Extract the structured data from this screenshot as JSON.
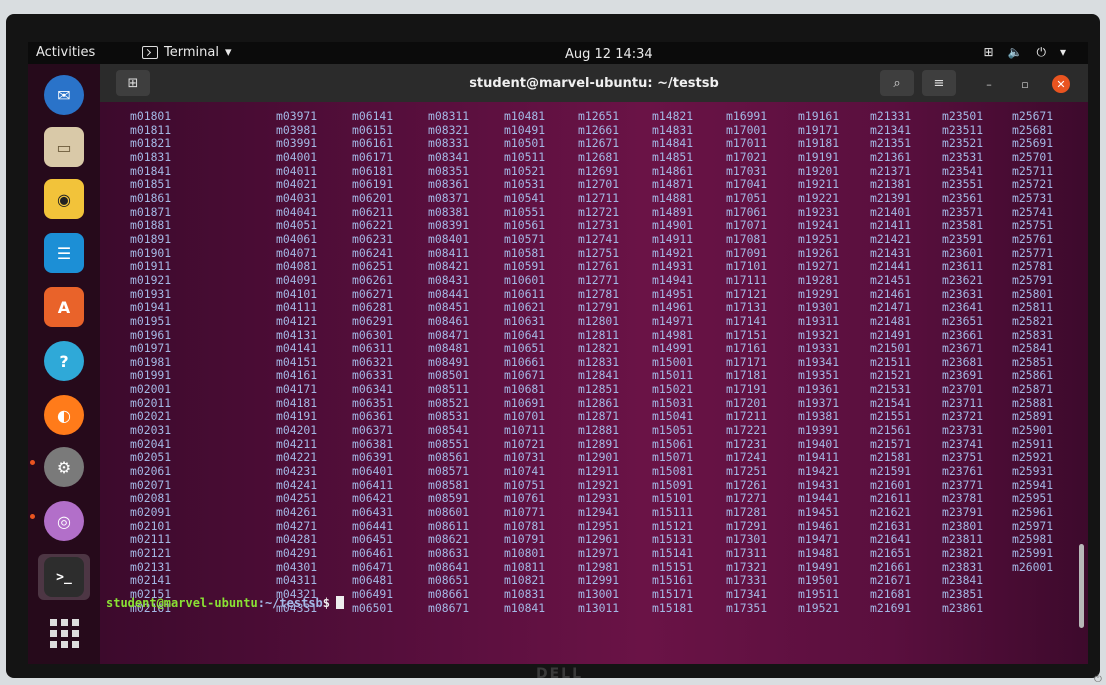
{
  "topbar": {
    "activities": "Activities",
    "app_name": "Terminal",
    "clock": "Aug 12  14:34"
  },
  "dock": {
    "items": [
      {
        "name": "thunderbird",
        "icon": "mail-bird-icon",
        "color": "#2a73c9"
      },
      {
        "name": "files",
        "icon": "folder-icon",
        "color": "#d9c9a8"
      },
      {
        "name": "rhythmbox",
        "icon": "speaker-icon",
        "color": "#f2c33a"
      },
      {
        "name": "writer",
        "icon": "document-icon",
        "color": "#1c8fd6"
      },
      {
        "name": "software",
        "icon": "shopping-bag-icon",
        "color": "#e9632a"
      },
      {
        "name": "help",
        "icon": "help-icon",
        "color": "#2fa9d8"
      },
      {
        "name": "firefox",
        "icon": "firefox-icon",
        "color": "#ff7b1a"
      },
      {
        "name": "settings",
        "icon": "gear-icon",
        "color": "#7a7a7a"
      },
      {
        "name": "browser",
        "icon": "globe-icon",
        "color": "#b26fc9"
      },
      {
        "name": "terminal",
        "icon": "terminal-icon",
        "color": "#2d2d2d"
      },
      {
        "name": "show-apps",
        "icon": "grid-icon",
        "color": "#dddddd"
      }
    ]
  },
  "terminal": {
    "title": "student@marvel-ubuntu: ~/testsb",
    "prompt_user": "student@marvel-ubuntu",
    "prompt_path": ":~/testsb",
    "prompt_symbol": "$",
    "text_color": "#a4b9e6",
    "prompt_color": "#8ae234",
    "columns": [
      [
        "m01801",
        "m01811",
        "m01821",
        "m01831",
        "m01841",
        "m01851",
        "m01861",
        "m01871",
        "m01881",
        "m01891",
        "m01901",
        "m01911",
        "m01921",
        "m01931",
        "m01941",
        "m01951",
        "m01961",
        "m01971",
        "m01981",
        "m01991",
        "m02001",
        "m02011",
        "m02021",
        "m02031",
        "m02041",
        "m02051",
        "m02061",
        "m02071",
        "m02081",
        "m02091",
        "m02101",
        "m02111",
        "m02121",
        "m02131",
        "m02141",
        "m02151",
        "m02161"
      ],
      [
        "m03971",
        "m03981",
        "m03991",
        "m04001",
        "m04011",
        "m04021",
        "m04031",
        "m04041",
        "m04051",
        "m04061",
        "m04071",
        "m04081",
        "m04091",
        "m04101",
        "m04111",
        "m04121",
        "m04131",
        "m04141",
        "m04151",
        "m04161",
        "m04171",
        "m04181",
        "m04191",
        "m04201",
        "m04211",
        "m04221",
        "m04231",
        "m04241",
        "m04251",
        "m04261",
        "m04271",
        "m04281",
        "m04291",
        "m04301",
        "m04311",
        "m04321",
        "m04331"
      ],
      [
        "m06141",
        "m06151",
        "m06161",
        "m06171",
        "m06181",
        "m06191",
        "m06201",
        "m06211",
        "m06221",
        "m06231",
        "m06241",
        "m06251",
        "m06261",
        "m06271",
        "m06281",
        "m06291",
        "m06301",
        "m06311",
        "m06321",
        "m06331",
        "m06341",
        "m06351",
        "m06361",
        "m06371",
        "m06381",
        "m06391",
        "m06401",
        "m06411",
        "m06421",
        "m06431",
        "m06441",
        "m06451",
        "m06461",
        "m06471",
        "m06481",
        "m06491",
        "m06501"
      ],
      [
        "m08311",
        "m08321",
        "m08331",
        "m08341",
        "m08351",
        "m08361",
        "m08371",
        "m08381",
        "m08391",
        "m08401",
        "m08411",
        "m08421",
        "m08431",
        "m08441",
        "m08451",
        "m08461",
        "m08471",
        "m08481",
        "m08491",
        "m08501",
        "m08511",
        "m08521",
        "m08531",
        "m08541",
        "m08551",
        "m08561",
        "m08571",
        "m08581",
        "m08591",
        "m08601",
        "m08611",
        "m08621",
        "m08631",
        "m08641",
        "m08651",
        "m08661",
        "m08671"
      ],
      [
        "m10481",
        "m10491",
        "m10501",
        "m10511",
        "m10521",
        "m10531",
        "m10541",
        "m10551",
        "m10561",
        "m10571",
        "m10581",
        "m10591",
        "m10601",
        "m10611",
        "m10621",
        "m10631",
        "m10641",
        "m10651",
        "m10661",
        "m10671",
        "m10681",
        "m10691",
        "m10701",
        "m10711",
        "m10721",
        "m10731",
        "m10741",
        "m10751",
        "m10761",
        "m10771",
        "m10781",
        "m10791",
        "m10801",
        "m10811",
        "m10821",
        "m10831",
        "m10841"
      ],
      [
        "m12651",
        "m12661",
        "m12671",
        "m12681",
        "m12691",
        "m12701",
        "m12711",
        "m12721",
        "m12731",
        "m12741",
        "m12751",
        "m12761",
        "m12771",
        "m12781",
        "m12791",
        "m12801",
        "m12811",
        "m12821",
        "m12831",
        "m12841",
        "m12851",
        "m12861",
        "m12871",
        "m12881",
        "m12891",
        "m12901",
        "m12911",
        "m12921",
        "m12931",
        "m12941",
        "m12951",
        "m12961",
        "m12971",
        "m12981",
        "m12991",
        "m13001",
        "m13011"
      ],
      [
        "m14821",
        "m14831",
        "m14841",
        "m14851",
        "m14861",
        "m14871",
        "m14881",
        "m14891",
        "m14901",
        "m14911",
        "m14921",
        "m14931",
        "m14941",
        "m14951",
        "m14961",
        "m14971",
        "m14981",
        "m14991",
        "m15001",
        "m15011",
        "m15021",
        "m15031",
        "m15041",
        "m15051",
        "m15061",
        "m15071",
        "m15081",
        "m15091",
        "m15101",
        "m15111",
        "m15121",
        "m15131",
        "m15141",
        "m15151",
        "m15161",
        "m15171",
        "m15181"
      ],
      [
        "m16991",
        "m17001",
        "m17011",
        "m17021",
        "m17031",
        "m17041",
        "m17051",
        "m17061",
        "m17071",
        "m17081",
        "m17091",
        "m17101",
        "m17111",
        "m17121",
        "m17131",
        "m17141",
        "m17151",
        "m17161",
        "m17171",
        "m17181",
        "m17191",
        "m17201",
        "m17211",
        "m17221",
        "m17231",
        "m17241",
        "m17251",
        "m17261",
        "m17271",
        "m17281",
        "m17291",
        "m17301",
        "m17311",
        "m17321",
        "m17331",
        "m17341",
        "m17351"
      ],
      [
        "m19161",
        "m19171",
        "m19181",
        "m19191",
        "m19201",
        "m19211",
        "m19221",
        "m19231",
        "m19241",
        "m19251",
        "m19261",
        "m19271",
        "m19281",
        "m19291",
        "m19301",
        "m19311",
        "m19321",
        "m19331",
        "m19341",
        "m19351",
        "m19361",
        "m19371",
        "m19381",
        "m19391",
        "m19401",
        "m19411",
        "m19421",
        "m19431",
        "m19441",
        "m19451",
        "m19461",
        "m19471",
        "m19481",
        "m19491",
        "m19501",
        "m19511",
        "m19521"
      ],
      [
        "m21331",
        "m21341",
        "m21351",
        "m21361",
        "m21371",
        "m21381",
        "m21391",
        "m21401",
        "m21411",
        "m21421",
        "m21431",
        "m21441",
        "m21451",
        "m21461",
        "m21471",
        "m21481",
        "m21491",
        "m21501",
        "m21511",
        "m21521",
        "m21531",
        "m21541",
        "m21551",
        "m21561",
        "m21571",
        "m21581",
        "m21591",
        "m21601",
        "m21611",
        "m21621",
        "m21631",
        "m21641",
        "m21651",
        "m21661",
        "m21671",
        "m21681",
        "m21691"
      ],
      [
        "m23501",
        "m23511",
        "m23521",
        "m23531",
        "m23541",
        "m23551",
        "m23561",
        "m23571",
        "m23581",
        "m23591",
        "m23601",
        "m23611",
        "m23621",
        "m23631",
        "m23641",
        "m23651",
        "m23661",
        "m23671",
        "m23681",
        "m23691",
        "m23701",
        "m23711",
        "m23721",
        "m23731",
        "m23741",
        "m23751",
        "m23761",
        "m23771",
        "m23781",
        "m23791",
        "m23801",
        "m23811",
        "m23821",
        "m23831",
        "m23841",
        "m23851",
        "m23861"
      ],
      [
        "m25671",
        "m25681",
        "m25691",
        "m25701",
        "m25711",
        "m25721",
        "m25731",
        "m25741",
        "m25751",
        "m25761",
        "m25771",
        "m25781",
        "m25791",
        "m25801",
        "m25811",
        "m25821",
        "m25831",
        "m25841",
        "m25851",
        "m25861",
        "m25871",
        "m25881",
        "m25891",
        "m25901",
        "m25911",
        "m25921",
        "m25931",
        "m25941",
        "m25951",
        "m25961",
        "m25971",
        "m25981",
        "m25991",
        "m26001"
      ]
    ]
  },
  "colors": {
    "accent": "#e95420",
    "topbar_bg": "#0b0b0b",
    "titlebar_bg": "#2b2b2b"
  }
}
